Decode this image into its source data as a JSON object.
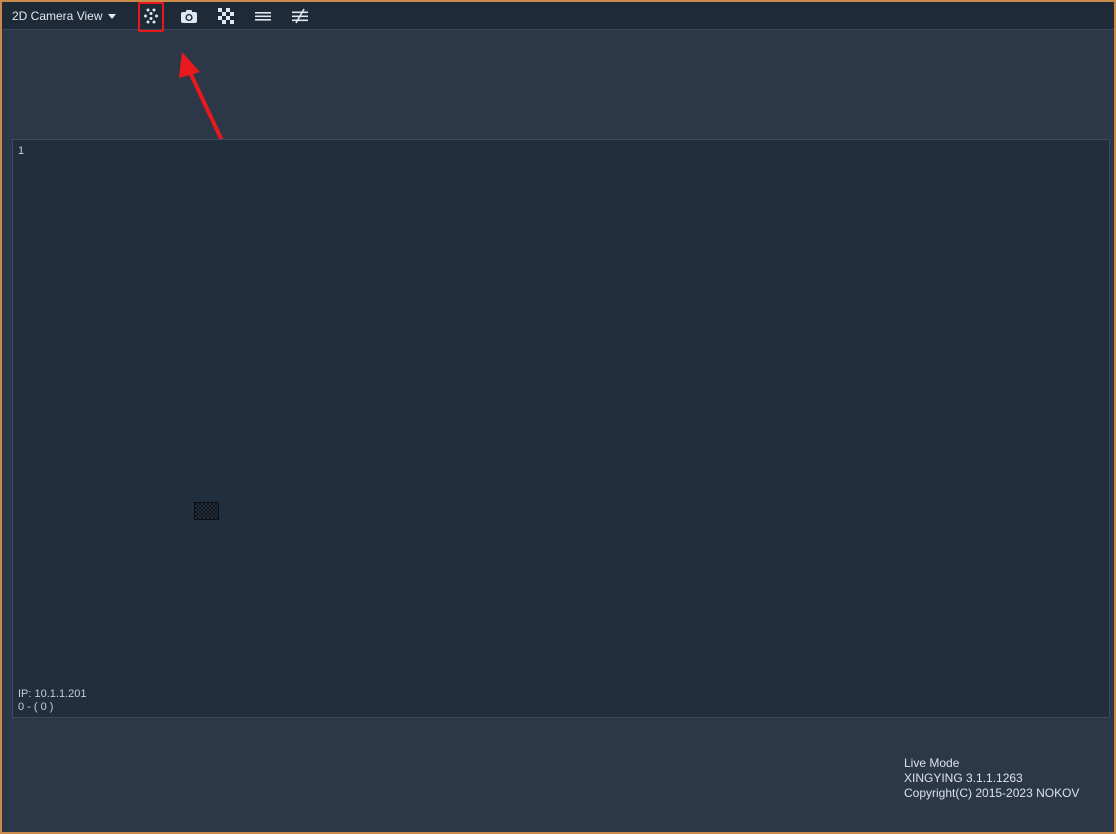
{
  "toolbar": {
    "view_selector": "2D Camera View",
    "buttons": [
      {
        "name": "marker-mode-button",
        "icon": "dots-pattern-icon"
      },
      {
        "name": "snapshot-button",
        "icon": "camera-icon"
      },
      {
        "name": "grayscale-mode-button",
        "icon": "checkerboard-icon"
      },
      {
        "name": "menu-button",
        "icon": "menu-lines-icon"
      },
      {
        "name": "filter-button",
        "icon": "not-equal-icon"
      }
    ]
  },
  "colors": {
    "accent_highlight": "#e8191c",
    "window_border": "#c98a4a",
    "toolbar_bg": "#1e2a38",
    "panel_bg": "#202e3d",
    "app_bg": "#2c3848"
  },
  "camera": {
    "number": "1",
    "ip": "IP: 10.1.1.201",
    "marker_count": "0 - ( 0 )"
  },
  "status": {
    "mode": "Live Mode",
    "version": "XINGYING 3.1.1.1263",
    "copyright": "Copyright(C) 2015-2023 NOKOV"
  }
}
